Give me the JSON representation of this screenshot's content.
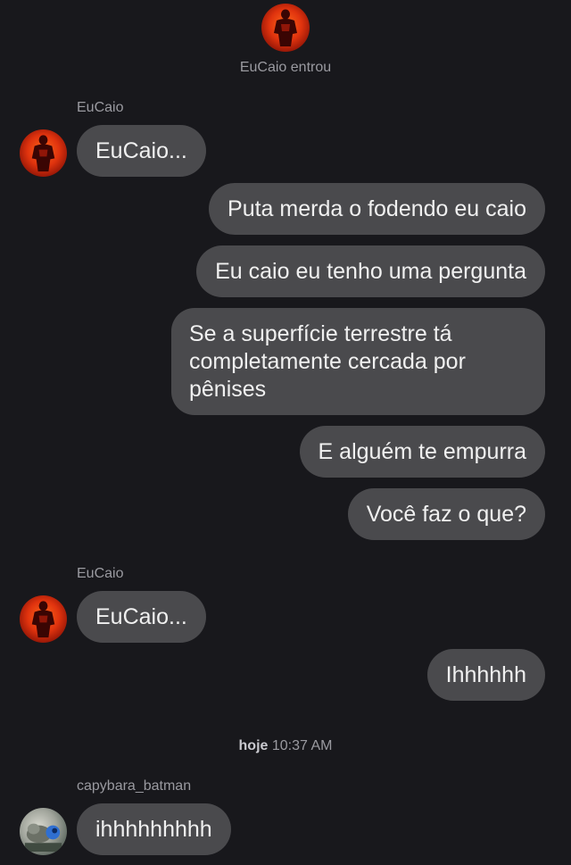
{
  "join_notice": "EuCaio entrou",
  "messages": [
    {
      "sender": "EuCaio",
      "text": "EuCaio..."
    },
    {
      "text": "Puta merda o fodendo eu caio"
    },
    {
      "text": "Eu caio eu tenho uma pergunta"
    },
    {
      "text": "Se a superfície terrestre tá completamente cercada por pênises"
    },
    {
      "text": "E alguém te empurra"
    },
    {
      "text": "Você faz o que?"
    },
    {
      "sender": "EuCaio",
      "text": "EuCaio..."
    },
    {
      "text": "Ihhhhhh"
    },
    {
      "sender": "capybara_batman",
      "text": "ihhhhhhhhh"
    }
  ],
  "timestamp": {
    "day": "hoje",
    "time": "10:37 AM"
  },
  "avatars": {
    "eucaio": "red-muscle-figure-avatar",
    "capybara": "capybara-photo-avatar"
  },
  "colors": {
    "background": "#18181c",
    "bubble": "#4a4a4d",
    "meta_text": "#9a9aa0"
  }
}
